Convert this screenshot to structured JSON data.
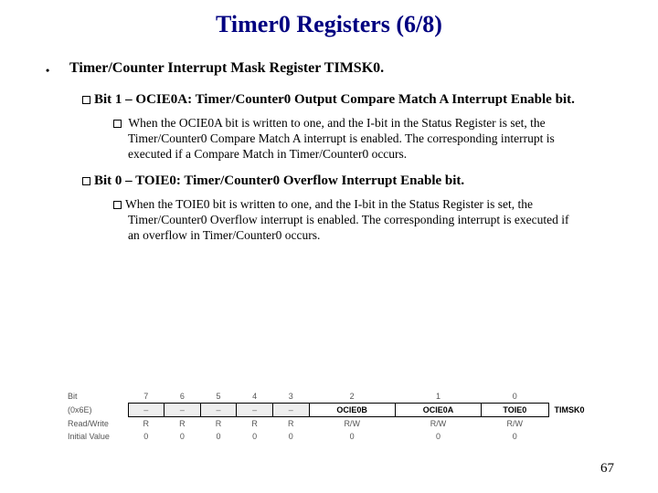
{
  "title": "Timer0 Registers (6/8)",
  "level1_bullet": "•",
  "level1_text": "Timer/Counter Interrupt Mask Register TIMSK0.",
  "bit1_heading": "Bit 1 – OCIE0A: Timer/Counter0 Output Compare Match A Interrupt Enable bit.",
  "bit1_desc": "When the OCIE0A bit is written to one, and the I-bit in the Status Register is set, the Timer/Counter0 Compare Match A interrupt is enabled. The corresponding interrupt is executed if a Compare Match in Timer/Counter0 occurs.",
  "bit0_heading": "Bit 0 – TOIE0: Timer/Counter0 Overflow Interrupt Enable bit.",
  "bit0_desc": "When the TOIE0 bit is written to one, and the I-bit in the Status Register is set, the Timer/Counter0 Overflow interrupt is enabled. The corresponding interrupt is executed if an overflow in Timer/Counter0 occurs.",
  "diagram": {
    "row_bit_label": "Bit",
    "row_addr_label": "(0x6E)",
    "row_rw_label": "Read/Write",
    "row_iv_label": "Initial Value",
    "bits": [
      "7",
      "6",
      "5",
      "4",
      "3",
      "2",
      "1",
      "0"
    ],
    "names": [
      "–",
      "–",
      "–",
      "–",
      "–",
      "OCIE0B",
      "OCIE0A",
      "TOIE0"
    ],
    "rw": [
      "R",
      "R",
      "R",
      "R",
      "R",
      "R/W",
      "R/W",
      "R/W"
    ],
    "iv": [
      "0",
      "0",
      "0",
      "0",
      "0",
      "0",
      "0",
      "0"
    ],
    "reg_name": "TIMSK0"
  },
  "page_number": "67"
}
